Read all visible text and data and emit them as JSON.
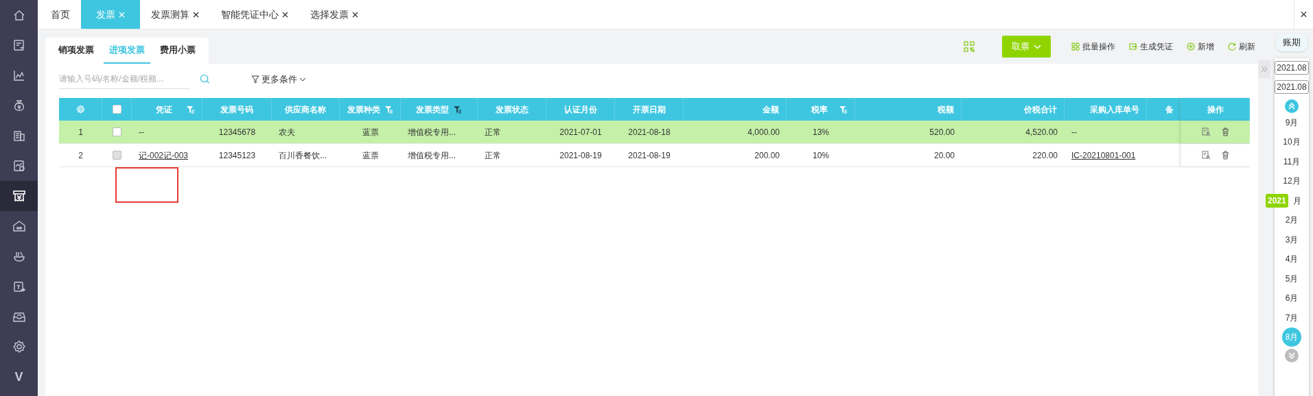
{
  "sidebar": {
    "items": [
      {
        "kind": "home",
        "selected": false
      },
      {
        "kind": "invoice",
        "selected": false
      },
      {
        "kind": "chart",
        "selected": false
      },
      {
        "kind": "moneybag",
        "selected": false
      },
      {
        "kind": "building",
        "selected": false
      },
      {
        "kind": "report",
        "selected": false
      },
      {
        "kind": "receipt",
        "selected": true
      },
      {
        "kind": "house",
        "selected": false
      },
      {
        "kind": "bowl",
        "selected": false
      },
      {
        "kind": "transfer",
        "selected": false
      },
      {
        "kind": "inbox",
        "selected": false
      },
      {
        "kind": "settings",
        "selected": false
      },
      {
        "kind": "glyph",
        "text": "V",
        "selected": false
      }
    ]
  },
  "tabs": [
    {
      "label": "首页",
      "closable": false,
      "selected": false
    },
    {
      "label": "发票",
      "closable": true,
      "selected": true
    },
    {
      "label": "发票测算",
      "closable": true,
      "selected": false
    },
    {
      "label": "智能凭证中心",
      "closable": true,
      "selected": false
    },
    {
      "label": "选择发票",
      "closable": true,
      "selected": false
    }
  ],
  "close_all": "×",
  "subtabs": [
    {
      "label": "销项发票",
      "selected": false
    },
    {
      "label": "进项发票",
      "selected": true
    },
    {
      "label": "费用小票",
      "selected": false
    }
  ],
  "toolbar": {
    "primary": "取票",
    "actions": [
      {
        "kind": "batch",
        "label": "批量操作"
      },
      {
        "kind": "voucher",
        "label": "生成凭证"
      },
      {
        "kind": "add",
        "label": "新增"
      },
      {
        "kind": "refresh",
        "label": "刷新"
      }
    ]
  },
  "search": {
    "placeholder": "请输入号码/名称/金额/税额..."
  },
  "more_filters": "更多条件",
  "table": {
    "all_checked": false,
    "columns": [
      {
        "kind": "settings",
        "filterable": false
      },
      {
        "kind": "checkbox",
        "filterable": false
      },
      {
        "label": "凭证",
        "kind": "text",
        "filterable": true,
        "filter_active": false
      },
      {
        "label": "发票号码",
        "kind": "text",
        "filterable": false
      },
      {
        "label": "供应商名称",
        "kind": "text",
        "filterable": false
      },
      {
        "label": "发票种类",
        "kind": "text",
        "filterable": true,
        "filter_active": false
      },
      {
        "label": "发票类型",
        "kind": "text",
        "filterable": true,
        "filter_active": true
      },
      {
        "label": "发票状态",
        "kind": "text",
        "filterable": false
      },
      {
        "label": "认证月份",
        "kind": "text",
        "filterable": false
      },
      {
        "label": "开票日期",
        "kind": "text",
        "filterable": false
      },
      {
        "label": "金额",
        "kind": "text",
        "filterable": false
      },
      {
        "label": "税率",
        "kind": "text",
        "filterable": true,
        "filter_active": false
      },
      {
        "label": "税额",
        "kind": "text",
        "filterable": false
      },
      {
        "label": "价税合计",
        "kind": "text",
        "filterable": false
      },
      {
        "label": "采购入库单号",
        "kind": "text",
        "filterable": false
      },
      {
        "label": "备",
        "kind": "text",
        "filterable": false
      },
      {
        "label": "操作",
        "kind": "actions",
        "filterable": false
      }
    ],
    "rows": [
      {
        "selected": true,
        "checked": false,
        "disabled": false,
        "cells": [
          {
            "text": "1"
          },
          {},
          {
            "text": "--"
          },
          {
            "text": "12345678"
          },
          {
            "text": "农夫"
          },
          {
            "text": "蓝票"
          },
          {
            "text": "增值税专用..."
          },
          {
            "text": "正常"
          },
          {
            "text": "2021-07-01"
          },
          {
            "text": "2021-08-18"
          },
          {
            "text": "4,000.00"
          },
          {
            "text": "13%"
          },
          {
            "text": "520.00"
          },
          {
            "text": "4,520.00"
          },
          {
            "text": "--"
          },
          {},
          {}
        ]
      },
      {
        "selected": false,
        "checked": false,
        "disabled": true,
        "cells": [
          {
            "text": "2"
          },
          {},
          {
            "text": "记-002记-003",
            "link": true
          },
          {
            "text": "12345123"
          },
          {
            "text": "百川香餐饮..."
          },
          {
            "text": "蓝票"
          },
          {
            "text": "增值税专用..."
          },
          {
            "text": "正常"
          },
          {
            "text": "2021-08-19"
          },
          {
            "text": "2021-08-19"
          },
          {
            "text": "200.00"
          },
          {
            "text": "10%"
          },
          {
            "text": "20.00"
          },
          {
            "text": "220.00"
          },
          {
            "text": "IC-20210801-001",
            "link": true
          },
          {},
          {}
        ]
      }
    ]
  },
  "period": {
    "title": "账期",
    "from": "2021.08",
    "to": "2021.08",
    "year": "2021",
    "months": [
      {
        "label": "9月",
        "selected": false
      },
      {
        "label": "10月",
        "selected": false
      },
      {
        "label": "11月",
        "selected": false
      },
      {
        "label": "12月",
        "selected": false
      },
      {
        "label": "月",
        "selected": false
      },
      {
        "label": "2月",
        "selected": false
      },
      {
        "label": "3月",
        "selected": false
      },
      {
        "label": "4月",
        "selected": false
      },
      {
        "label": "5月",
        "selected": false
      },
      {
        "label": "6月",
        "selected": false
      },
      {
        "label": "7月",
        "selected": false
      },
      {
        "label": "8月",
        "selected": true
      }
    ]
  }
}
